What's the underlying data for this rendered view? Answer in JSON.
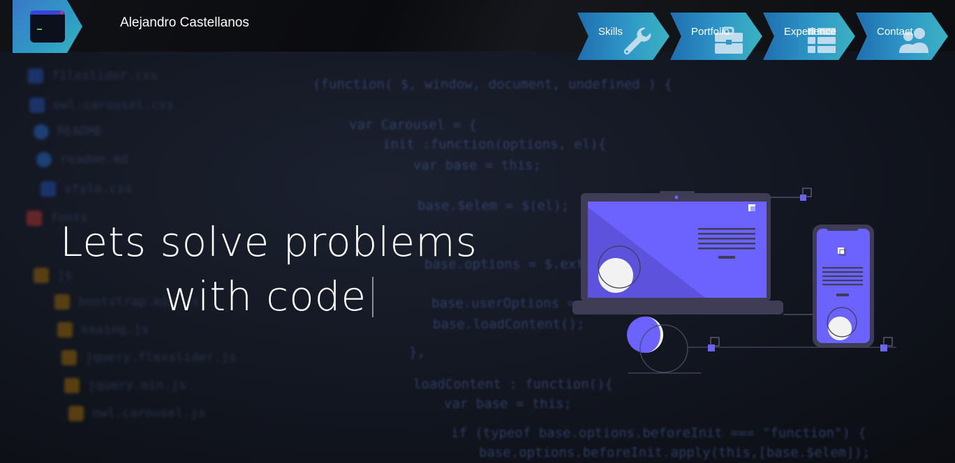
{
  "header": {
    "site_name": "Alejandro Castellanos"
  },
  "nav": {
    "items": [
      {
        "label": "Skills",
        "icon": "wrench-icon"
      },
      {
        "label": "Portfolio",
        "icon": "briefcase-icon"
      },
      {
        "label": "Experience",
        "icon": "list-icon"
      },
      {
        "label": "Contact",
        "icon": "users-icon"
      }
    ]
  },
  "hero": {
    "line1": "Lets solve problems",
    "line2": "with code"
  },
  "background_code": {
    "lines": [
      "(function( $, window, document, undefined ) {",
      "var Carousel = {",
      "init :function(options, el){",
      "var base = this;",
      "base.$elem = $(el);",
      "base.options = $.extend({",
      "base.userOptions = opti",
      "base.loadContent();",
      "},",
      "loadContent : function(){",
      "var base = this;",
      "if (typeof base.options.beforeInit === \"function\") {",
      "base.options.beforeInit.apply(this,[base.$elem]);"
    ],
    "files": [
      "fileslider.css",
      "owl.carousel.css",
      "README",
      "readme.md",
      "style.css",
      "fonts",
      "js",
      "bootstrap.min.js",
      "easing.js",
      "jquery.flexslider.js",
      "jquery.min.js",
      "owl.carousel.js"
    ]
  },
  "colors": {
    "accent": "#6c63ff",
    "nav_gradient_start": "#1f6fb0",
    "nav_gradient_end": "#3bb2c2",
    "device_frame": "#3f3d56"
  }
}
